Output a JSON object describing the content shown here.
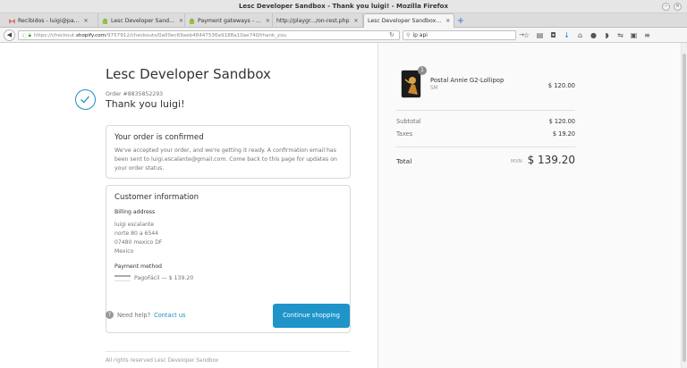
{
  "window": {
    "title": "Lesc Developer Sandbox - Thank you luigi! - Mozilla Firefox"
  },
  "tabs": [
    {
      "label": "Recibidos - luigi@pa...",
      "icon": "gmail-icon",
      "active": false
    },
    {
      "label": "Lesc Developer Sand...",
      "icon": "shopify-icon",
      "active": false
    },
    {
      "label": "Payment gateways - ...",
      "icon": "shopify-icon",
      "active": false
    },
    {
      "label": "http://playgr.../on-rest.php",
      "icon": "",
      "active": false
    },
    {
      "label": "Lesc Developer Sandbox...",
      "icon": "",
      "active": true
    }
  ],
  "nav": {
    "url_prefix": "https://checkout.",
    "url_host": "shopify.com",
    "url_path": "/9757912/checkouts/0a00ec69aeb48447536a9188a10ae740/thank_you",
    "search_value": "ip api"
  },
  "main": {
    "shop_title": "Lesc Developer Sandbox",
    "order_number": "Order #8835852293",
    "thanks": "Thank you luigi!",
    "confirm_title": "Your order is confirmed",
    "confirm_text": "We've accepted your order, and we're getting it ready. A confirmation email has been sent to luigi.escalante@gmail.com. Come back to this page for updates on your order status.",
    "customer_title": "Customer information",
    "billing_label": "Billing address",
    "address_lines": [
      "luigi escalante",
      "norte 80 a 6544",
      "07480 mexico DF",
      "Mexico"
    ],
    "payment_label": "Payment method",
    "payment_value": "PagoFácil — $ 139.20",
    "help_text": "Need help?",
    "help_link": "Contact us",
    "continue_label": "Continue shopping",
    "footer": "All rights reserved Lesc Developer Sandbox"
  },
  "summary": {
    "qty": "1",
    "item_name": "Postal Annie G2-Lollipop",
    "item_sub": "SM",
    "item_price": "$ 120.00",
    "subtotal_label": "Subtotal",
    "subtotal": "$ 120.00",
    "taxes_label": "Taxes",
    "taxes": "$ 19.20",
    "total_label": "Total",
    "currency": "MXN",
    "total": "$ 139.20"
  },
  "colors": {
    "accent": "#1f94c9",
    "link": "#1990c6"
  }
}
